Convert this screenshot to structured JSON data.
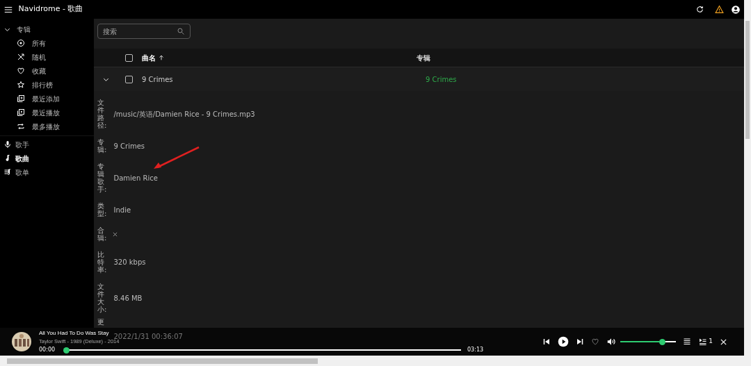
{
  "app_bar": {
    "title": "Navidrome - 歌曲"
  },
  "sidebar": {
    "group": {
      "label": "专辑",
      "expanded": true,
      "items": [
        {
          "label": "所有",
          "selected": false
        },
        {
          "label": "随机",
          "selected": false
        },
        {
          "label": "收藏",
          "selected": false
        },
        {
          "label": "排行榜",
          "selected": false
        },
        {
          "label": "最近添加",
          "selected": false
        },
        {
          "label": "最近播放",
          "selected": false
        },
        {
          "label": "最多播放",
          "selected": false
        }
      ]
    },
    "items": [
      {
        "label": "歌手",
        "selected": false
      },
      {
        "label": "歌曲",
        "selected": true
      },
      {
        "label": "歌单",
        "selected": false
      }
    ]
  },
  "search": {
    "placeholder": "搜索"
  },
  "table": {
    "select_all": {
      "checked": false
    },
    "columns": [
      {
        "label": "曲名",
        "sorted": true
      },
      {
        "label": "专辑"
      }
    ],
    "rows": [
      {
        "expanded": true,
        "checked": false,
        "title": "9 Crimes",
        "album": "9 Crimes",
        "details": [
          {
            "kind": "text",
            "label": "文件路径:",
            "value": "/music/英语/Damien Rice - 9 Crimes.mp3"
          },
          {
            "kind": "text",
            "label": "专辑:",
            "value": "9 Crimes"
          },
          {
            "kind": "text",
            "label": "专辑歌手:",
            "value": "Damien Rice"
          },
          {
            "kind": "text",
            "label": "类型:",
            "value": "Indie"
          },
          {
            "kind": "boolean",
            "label": "合辑:",
            "value": false
          },
          {
            "kind": "text",
            "label": "比特率:",
            "value": "320 kbps"
          },
          {
            "kind": "text",
            "label": "文件大小:",
            "value": "8.46 MB"
          },
          {
            "kind": "text",
            "label": "更",
            "value": "2022/1/31 00:36:07"
          }
        ]
      }
    ]
  },
  "player": {
    "title": "All You Had To Do Was Stay",
    "subtitle": "Taylor Swift - 1989 (Deluxe) - 2014",
    "current_time": "00:00",
    "duration": "03:13",
    "progress": {
      "level": 0
    },
    "liked": false,
    "volume": {
      "level": 0.75
    },
    "queue_count": "1"
  }
}
